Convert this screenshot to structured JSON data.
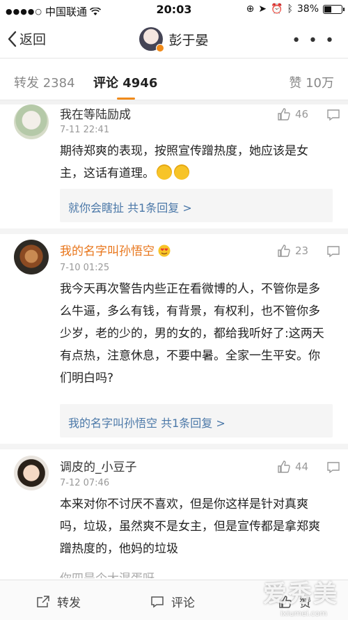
{
  "status_bar": {
    "carrier": "中国联通",
    "time": "20:03",
    "battery": "38%",
    "battery_level": 0.38
  },
  "nav": {
    "back_label": "返回",
    "title": "彭于晏",
    "more": "• • •"
  },
  "tabs": {
    "repost": "转发 2384",
    "comment": "评论 4946",
    "like": "赞 10万"
  },
  "comments": [
    {
      "username": "我在等陆励成",
      "time": "7-11 22:41",
      "likes": "46",
      "body": "期待郑爽的表现，按照宣传蹭热度，她应该是女主，这话有道理。",
      "reply_summary": "就你会瞎扯  共1条回复 >"
    },
    {
      "username": "我的名字叫孙悟空",
      "time": "7-10 01:25",
      "likes": "23",
      "body": "我今天再次警告内些正在看微博的人，不管你是多么牛逼，多么有钱，有背景，有权利，也不管你多少岁，老的少的，男的女的，都给我听好了:这两天有点热，注意休息，不要中暑。全家一生平安。你们明白吗?",
      "reply_summary": "我的名字叫孙悟空  共1条回复 >"
    },
    {
      "username": "调皮的_小豆子",
      "time": "7-12 07:46",
      "likes": "44",
      "body": "本来对你不讨厌不喜欢，但是你这样是针对真爽吗，垃圾，虽然爽不是女主，但是宣传都是拿郑爽蹭热度的，他妈的垃圾"
    }
  ],
  "partial_next": "你四是个大混蛋呀",
  "bottom_bar": {
    "repost": "转发",
    "comment": "评论",
    "like": "赞"
  },
  "watermark": {
    "main": "爱秀美",
    "sub": "ixiumei.com"
  },
  "colors": {
    "accent": "#f08a1a",
    "link": "#4b78a8",
    "vip_name": "#e8751a"
  }
}
